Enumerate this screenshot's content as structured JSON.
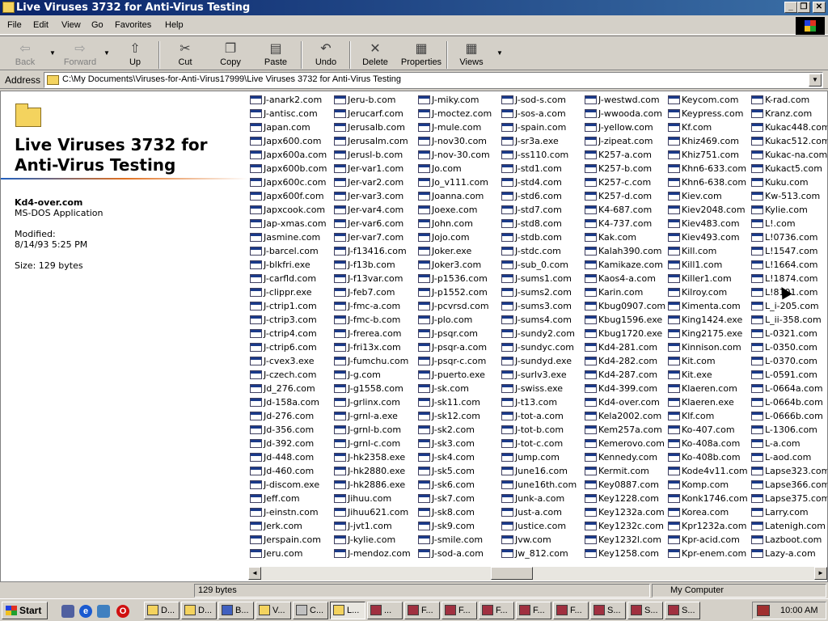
{
  "window": {
    "title": "Live Viruses 3732 for Anti-Virus Testing",
    "controls": {
      "minimize": "_",
      "maximize": "❐",
      "close": "✕"
    }
  },
  "menu": {
    "items": [
      "File",
      "Edit",
      "View",
      "Go",
      "Favorites",
      "Help"
    ]
  },
  "toolbar": {
    "back": "Back",
    "forward": "Forward",
    "up": "Up",
    "cut": "Cut",
    "copy": "Copy",
    "paste": "Paste",
    "undo": "Undo",
    "delete": "Delete",
    "properties": "Properties",
    "views": "Views"
  },
  "address": {
    "label": "Address",
    "value": "C:\\My Documents\\Viruses-for-Anti-Virus17999\\Live Viruses 3732 for Anti-Virus Testing"
  },
  "leftpane": {
    "folder_title": "Live Viruses 3732 for Anti-Virus Testing",
    "file_name": "Kd4-over.com",
    "file_type": "MS-DOS Application",
    "modified_label": "Modified:",
    "modified_value": "8/14/93 5:25 PM",
    "size": "Size: 129 bytes"
  },
  "files": {
    "columns": [
      [
        "J-anark2.com",
        "J-antisc.com",
        "Japan.com",
        "Japx600.com",
        "Japx600a.com",
        "Japx600b.com",
        "Japx600c.com",
        "Japx600f.com",
        "Japxcook.com",
        "Jap-xmas.com",
        "Jasmine.com",
        "J-barcel.com",
        "J-blkfri.exe",
        "J-carfld.com",
        "J-clippr.exe",
        "J-ctrip1.com",
        "J-ctrip3.com",
        "J-ctrip4.com",
        "J-ctrip6.com",
        "J-cvex3.exe",
        "J-czech.com",
        "Jd_276.com",
        "Jd-158a.com",
        "Jd-276.com",
        "Jd-356.com",
        "Jd-392.com",
        "Jd-448.com",
        "Jd-460.com",
        "J-discom.exe",
        "Jeff.com",
        "J-einstn.com",
        "Jerk.com",
        "Jerspain.com",
        "Jeru.com"
      ],
      [
        "Jeru-b.com",
        "Jerucarf.com",
        "Jerusalb.com",
        "Jerusalm.com",
        "Jerusl-b.com",
        "Jer-var1.com",
        "Jer-var2.com",
        "Jer-var3.com",
        "Jer-var4.com",
        "Jer-var6.com",
        "Jer-var7.com",
        "J-f13416.com",
        "J-f13b.com",
        "J-f13var.com",
        "J-feb7.com",
        "J-fmc-a.com",
        "J-fmc-b.com",
        "J-frerea.com",
        "J-fri13x.com",
        "J-fumchu.com",
        "J-g.com",
        "J-g1558.com",
        "J-grlinx.com",
        "J-grnl-a.exe",
        "J-grnl-b.com",
        "J-grnl-c.com",
        "J-hk2358.exe",
        "J-hk2880.exe",
        "J-hk2886.exe",
        "Jihuu.com",
        "Jihuu621.com",
        "J-jvt1.com",
        "J-kylie.com",
        "J-mendoz.com"
      ],
      [
        "J-miky.com",
        "J-moctez.com",
        "J-mule.com",
        "J-nov30.com",
        "J-nov-30.com",
        "Jo.com",
        "Jo_v111.com",
        "Joanna.com",
        "Joexe.com",
        "John.com",
        "Jojo.com",
        "Joker.exe",
        "Joker3.com",
        "J-p1536.com",
        "J-p1552.com",
        "J-pcvrsd.com",
        "J-plo.com",
        "J-psqr.com",
        "J-psqr-a.com",
        "J-psqr-c.com",
        "J-puerto.exe",
        "J-sk.com",
        "J-sk11.com",
        "J-sk12.com",
        "J-sk2.com",
        "J-sk3.com",
        "J-sk4.com",
        "J-sk5.com",
        "J-sk6.com",
        "J-sk7.com",
        "J-sk8.com",
        "J-sk9.com",
        "J-smile.com",
        "J-sod-a.com"
      ],
      [
        "J-sod-s.com",
        "J-sos-a.com",
        "J-spain.com",
        "J-sr3a.exe",
        "J-ss110.com",
        "J-std1.com",
        "J-std4.com",
        "J-std6.com",
        "J-std7.com",
        "J-std8.com",
        "J-stdb.com",
        "J-stdc.com",
        "J-sub_0.com",
        "J-sums1.com",
        "J-sums2.com",
        "J-sums3.com",
        "J-sums4.com",
        "J-sundy2.com",
        "J-sundyc.com",
        "J-sundyd.exe",
        "J-surlv3.exe",
        "J-swiss.exe",
        "J-t13.com",
        "J-tot-a.com",
        "J-tot-b.com",
        "J-tot-c.com",
        "Jump.com",
        "June16.com",
        "June16th.com",
        "Junk-a.com",
        "Just-a.com",
        "Justice.com",
        "Jvw.com",
        "Jw_812.com"
      ],
      [
        "J-westwd.com",
        "J-wwooda.com",
        "J-yellow.com",
        "J-zipeat.com",
        "K257-a.com",
        "K257-b.com",
        "K257-c.com",
        "K257-d.com",
        "K4-687.com",
        "K4-737.com",
        "Kak.com",
        "Kalah390.com",
        "Kamikaze.com",
        "Kaos4-a.com",
        "Karin.com",
        "Kbug0907.com",
        "Kbug1596.exe",
        "Kbug1720.exe",
        "Kd4-281.com",
        "Kd4-282.com",
        "Kd4-287.com",
        "Kd4-399.com",
        "Kd4-over.com",
        "Kela2002.com",
        "Kem257a.com",
        "Kemerovo.com",
        "Kennedy.com",
        "Kermit.com",
        "Key0887.com",
        "Key1228.com",
        "Key1232a.com",
        "Key1232c.com",
        "Key1232l.com",
        "Key1258.com"
      ],
      [
        "Keycom.com",
        "Keypress.com",
        "Kf.com",
        "Khiz469.com",
        "Khiz751.com",
        "Khn6-633.com",
        "Khn6-638.com",
        "Kiev.com",
        "Kiev2048.com",
        "Kiev483.com",
        "Kiev493.com",
        "Kill.com",
        "Kill1.com",
        "Killer1.com",
        "Kilroy.com",
        "Kimenta.com",
        "King1424.exe",
        "King2175.exe",
        "Kinnison.com",
        "Kit.com",
        "Kit.exe",
        "Klaeren.com",
        "Klaeren.exe",
        "Klf.com",
        "Ko-407.com",
        "Ko-408a.com",
        "Ko-408b.com",
        "Kode4v11.com",
        "Komp.com",
        "Konk1746.com",
        "Korea.com",
        "Kpr1232a.com",
        "Kpr-acid.com",
        "Kpr-enem.com"
      ],
      [
        "K-rad.com",
        "Kranz.com",
        "Kukac448.com",
        "Kukac512.com",
        "Kukac-na.com",
        "Kukact5.com",
        "Kuku.com",
        "Kw-513.com",
        "Kylie.com",
        "L!.com",
        "L!0736.com",
        "L!1547.com",
        "L!1664.com",
        "L!1874.com",
        "L!8101.com",
        "L_i-205.com",
        "L_ii-358.com",
        "L-0321.com",
        "L-0350.com",
        "L-0370.com",
        "L-0591.com",
        "L-0664a.com",
        "L-0664b.com",
        "L-0666b.com",
        "L-1306.com",
        "L-a.com",
        "L-aod.com",
        "Lapse323.com",
        "Lapse366.com",
        "Lapse375.com",
        "Larry.com",
        "Latenigh.com",
        "Lazboot.com",
        "Lazy-a.com"
      ]
    ]
  },
  "scrollbar": {
    "left": "◄",
    "right": "►"
  },
  "status": {
    "size": "129 bytes",
    "location": "My Computer"
  },
  "taskbar": {
    "start": "Start",
    "tasks": [
      "D...",
      "D...",
      "B...",
      "V...",
      "C...",
      "L...",
      "...",
      "F...",
      "F...",
      "F...",
      "F...",
      "F...",
      "S...",
      "S...",
      "S..."
    ],
    "clock": "10:00 AM"
  },
  "colors": {
    "title_start": "#0a246a",
    "title_end": "#3a6ea5",
    "folder": "#f4d35e",
    "chrome": "#d4d0c8"
  }
}
